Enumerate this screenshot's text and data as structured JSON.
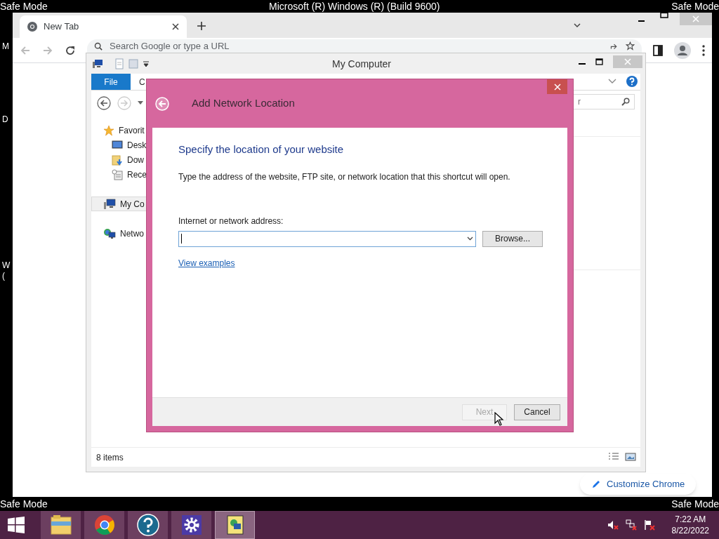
{
  "desktop": {
    "watermarks": [
      "Safe Mode",
      "Microsoft (R) Windows (R) (Build 9600)",
      "Safe Mode",
      "Safe Mode",
      "Safe Mode"
    ],
    "edge_fragments": [
      "M",
      "D",
      "W",
      "("
    ]
  },
  "browser": {
    "tabs": [
      {
        "label": "New Tab",
        "selected": true
      }
    ],
    "address": {
      "placeholder": "Search Google or type a URL"
    },
    "customize_button": "Customize Chrome"
  },
  "explorer": {
    "title": "My Computer",
    "ribbon_tabs": [
      {
        "label": "File",
        "kind": "file"
      },
      {
        "label": "C",
        "kind": "tab"
      }
    ],
    "search": {
      "placeholder": "r"
    },
    "nav": [
      {
        "label": "Favorit",
        "kind": "star",
        "selected": false,
        "children": [
          {
            "label": "Desk",
            "kind": "desktop",
            "selected": false
          },
          {
            "label": "Dow",
            "kind": "downloads",
            "selected": false
          },
          {
            "label": "Rece",
            "kind": "recent",
            "selected": false
          }
        ]
      },
      {
        "label": "My Co",
        "kind": "computer",
        "selected": true
      },
      {
        "label": "Netwo",
        "kind": "network",
        "selected": false
      }
    ],
    "status": "8 items"
  },
  "dialog": {
    "title": "Add Network Location",
    "heading": "Specify the location of your website",
    "description": "Type the address of the website, FTP site, or network location that this shortcut will open.",
    "field_label": "Internet or network address:",
    "link": "View examples",
    "buttons": [
      {
        "label": "Browse...",
        "kind": "browse",
        "disabled": false
      },
      {
        "label": "Next",
        "kind": "footer",
        "disabled": true
      },
      {
        "label": "Cancel",
        "kind": "footer",
        "disabled": false
      }
    ]
  },
  "taskbar": {
    "apps": [
      {
        "kind": "explorer",
        "selected": false
      },
      {
        "kind": "chrome",
        "selected": false
      },
      {
        "kind": "help",
        "selected": false
      },
      {
        "kind": "settings",
        "selected": false
      },
      {
        "kind": "network-app",
        "selected": true
      }
    ],
    "clock": {
      "time": "7:22 AM",
      "date": "8/22/2022"
    }
  }
}
